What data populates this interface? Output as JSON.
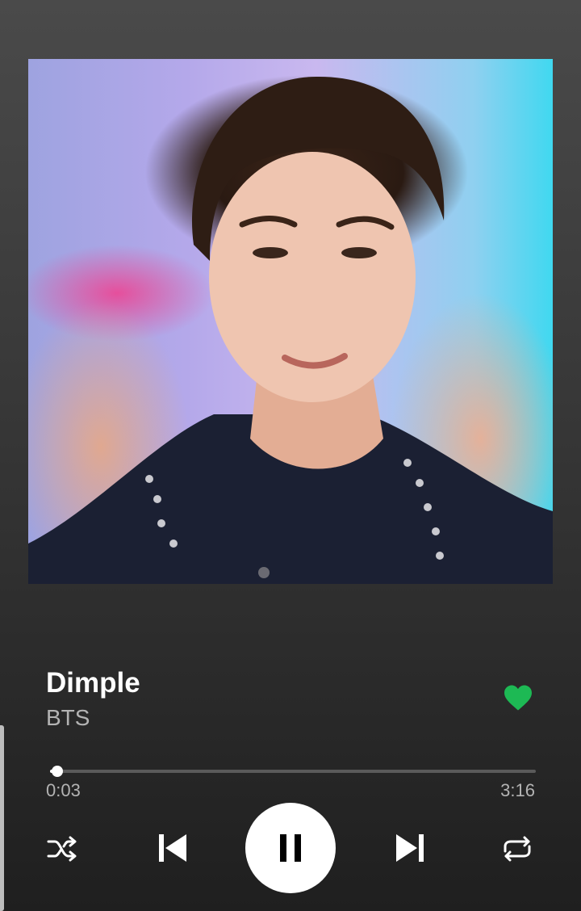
{
  "track": {
    "title": "Dimple",
    "artist": "BTS",
    "liked": true
  },
  "playback": {
    "elapsed": "0:03",
    "duration": "3:16",
    "progress_fraction": 0.015,
    "state": "playing"
  },
  "controls": {
    "shuffle_icon": "shuffle-icon",
    "previous_icon": "skip-previous-icon",
    "pause_icon": "pause-icon",
    "next_icon": "skip-next-icon",
    "repeat_icon": "repeat-icon"
  },
  "colors": {
    "accent": "#1db954",
    "text_primary": "#ffffff",
    "text_secondary": "#b3b3b3"
  }
}
